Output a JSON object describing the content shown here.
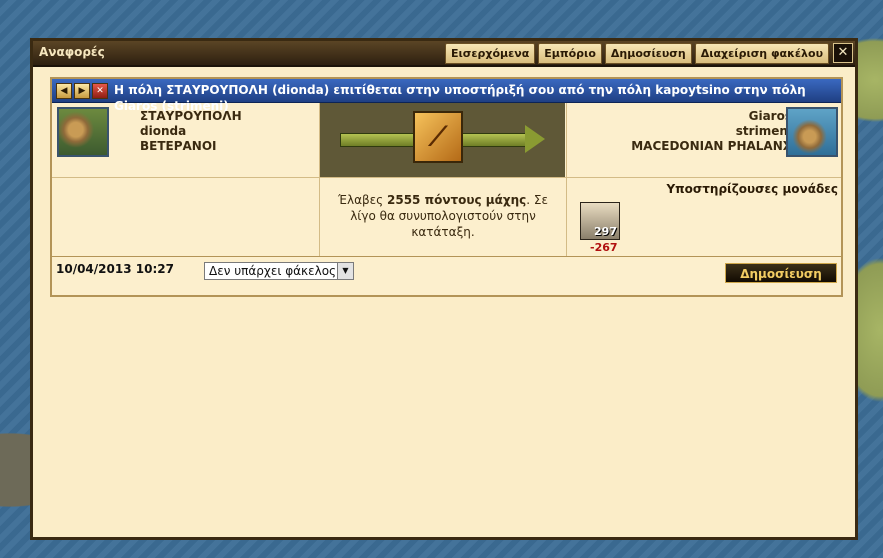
{
  "window": {
    "title": "Αναφορές",
    "tabs": [
      "Εισερχόμενα",
      "Εμπόριο",
      "Δημοσίευση",
      "Διαχείριση φακέλου"
    ],
    "close_label": "✕"
  },
  "report": {
    "nav": {
      "prev": "◀",
      "next": "▶",
      "delete": "✕"
    },
    "headline": "Η πόλη ΣΤΑΥΡΟΥΠΟΛΗ (dionda) επιτίθεται στην υποστήριξή σου από την πόλη kapoytsino στην πόλη Giaros (strimeni)",
    "attacker": {
      "town": "ΣΤΑΥΡΟΥΠΟΛΗ",
      "player": "dionda",
      "alliance": "ΒΕΤΕΡΑΝΟΙ"
    },
    "defender": {
      "town": "Giaros",
      "player": "strimeni",
      "alliance": "MACEDONIAN PHALANX"
    },
    "points": {
      "prefix": "Έλαβες",
      "value": "2555 πόντους μάχης",
      "suffix": ". Σε λίγο θα συνυπολογιστούν στην κατάταξη."
    },
    "supporting_title": "Υποστηρίζουσες μονάδες",
    "unit": {
      "count": "297",
      "loss": "-267"
    },
    "date": "10/04/2013 10:27",
    "folder_select": "Δεν υπάρχει φάκελος",
    "publish_label": "Δημοσίευση"
  },
  "colors": {
    "header_blue": "#2a4f9a",
    "parchment": "#fbedc8",
    "loss_red": "#b01010"
  }
}
